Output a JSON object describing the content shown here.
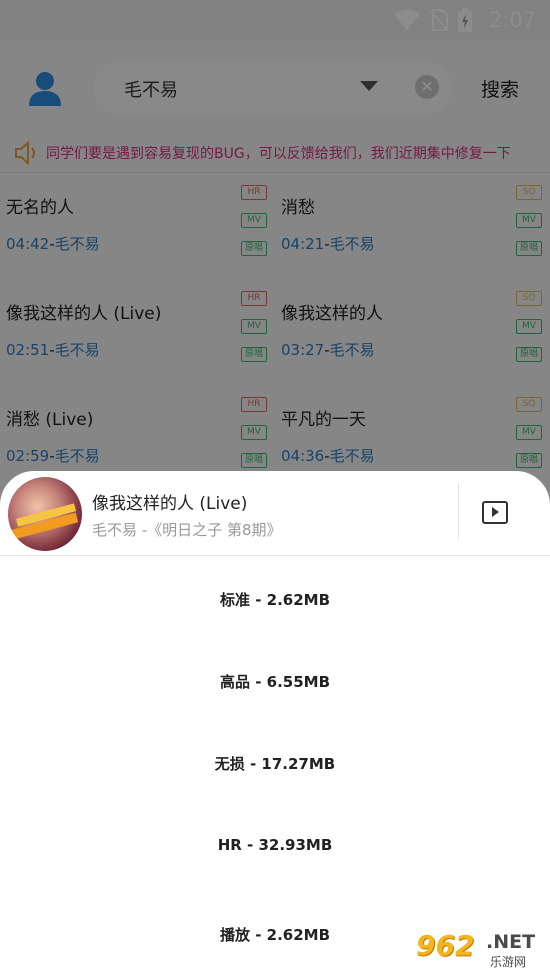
{
  "status": {
    "time": "2:07"
  },
  "header": {
    "search_value": "毛不易",
    "search_button": "搜索"
  },
  "notice": {
    "text": "同学们要是遇到容易复现的BUG，可以反馈给我们，我们近期集中修复一下"
  },
  "songs": [
    {
      "title": "无名的人",
      "time": "04:42",
      "artist": "毛不易",
      "quality": "HR",
      "mv": "MV",
      "orig": "原唱"
    },
    {
      "title": "消愁",
      "time": "04:21",
      "artist": "毛不易",
      "quality": "SQ",
      "mv": "MV",
      "orig": "原唱"
    },
    {
      "title": "像我这样的人 (Live)",
      "time": "02:51",
      "artist": "毛不易",
      "quality": "HR",
      "mv": "MV",
      "orig": "原唱"
    },
    {
      "title": "像我这样的人",
      "time": "03:27",
      "artist": "毛不易",
      "quality": "SQ",
      "mv": "MV",
      "orig": "原唱"
    },
    {
      "title": "消愁 (Live)",
      "time": "02:59",
      "artist": "毛不易",
      "quality": "HR",
      "mv": "MV",
      "orig": "原唱"
    },
    {
      "title": "平凡的一天",
      "time": "04:36",
      "artist": "毛不易",
      "quality": "SQ",
      "mv": "MV",
      "orig": "原唱"
    }
  ],
  "sheet": {
    "title": "像我这样的人 (Live)",
    "subtitle": "毛不易 -《明日之子 第8期》",
    "options": [
      "标准 - 2.62MB",
      "高品 - 6.55MB",
      "无损 - 17.27MB",
      "HR - 32.93MB",
      "播放 - 2.62MB"
    ]
  },
  "watermark": {
    "num": "962",
    "net": ".NET",
    "cn": "乐游网"
  },
  "colors": {
    "accent_blue": "#2f7ac0",
    "notice_pink": "#d6317c",
    "hr": "#d96a5b",
    "sq": "#e5b463",
    "mv": "#3fb66f"
  }
}
